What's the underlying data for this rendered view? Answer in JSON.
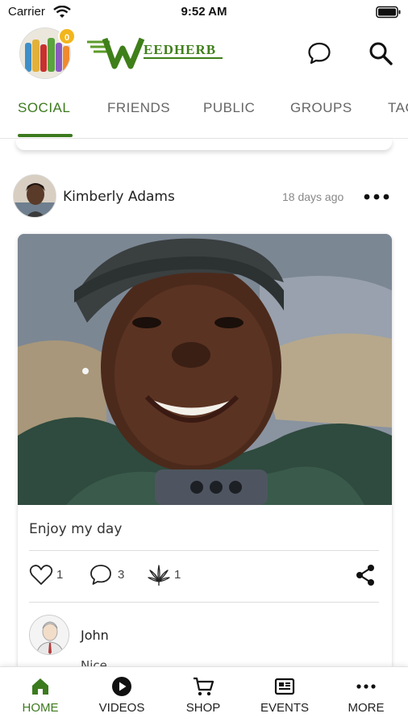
{
  "status_bar": {
    "carrier": "Carrier",
    "time": "9:52 AM"
  },
  "header": {
    "badge_count": "0",
    "logo_text": "WEEDHERB",
    "icons": [
      "chat-icon",
      "search-icon"
    ]
  },
  "tabs": [
    {
      "label": "SOCIAL",
      "active": true
    },
    {
      "label": "FRIENDS",
      "active": false
    },
    {
      "label": "PUBLIC",
      "active": false
    },
    {
      "label": "GROUPS",
      "active": false
    },
    {
      "label": "TAG",
      "active": false
    }
  ],
  "post": {
    "author": "Kimberly Adams",
    "time_ago": "18 days ago",
    "caption": "Enjoy my day",
    "likes": "1",
    "comments": "3",
    "weed_reactions": "1",
    "comment": {
      "author": "John",
      "text": "Nice"
    }
  },
  "bottom_nav": [
    {
      "label": "HOME",
      "icon": "home-icon",
      "active": true
    },
    {
      "label": "VIDEOS",
      "icon": "play-icon",
      "active": false
    },
    {
      "label": "SHOP",
      "icon": "cart-icon",
      "active": false
    },
    {
      "label": "EVENTS",
      "icon": "news-icon",
      "active": false
    },
    {
      "label": "MORE",
      "icon": "more-icon",
      "active": false
    }
  ],
  "colors": {
    "accent": "#3c7a1e",
    "badge": "#f2b51d"
  }
}
